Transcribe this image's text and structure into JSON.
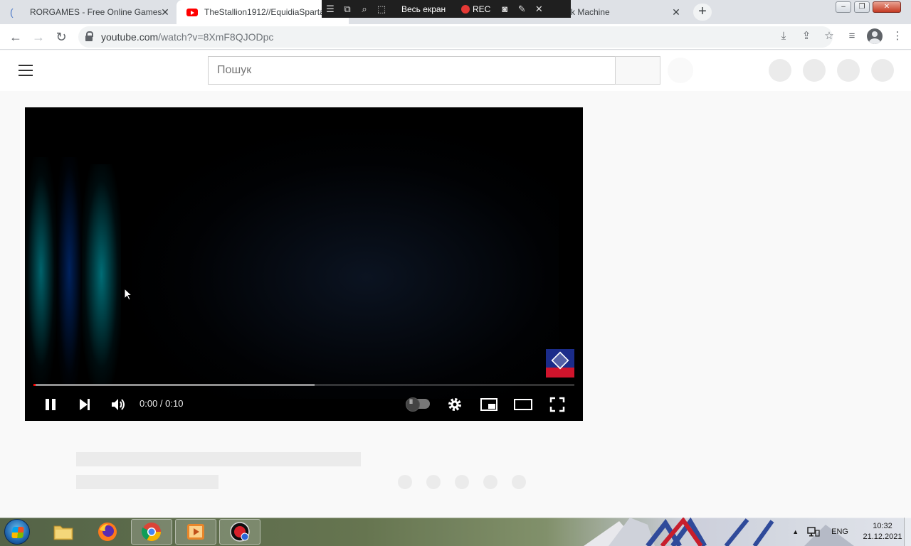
{
  "browser": {
    "tabs": [
      {
        "title": "RORGAMES - Free Online Games",
        "active": false
      },
      {
        "title": "TheStallion1912//EquidiaSparta",
        "active": true
      },
      {
        "title": "k Machine",
        "active": false
      }
    ],
    "close_glyph": "✕",
    "newtab_glyph": "+",
    "url_host": "youtube.com",
    "url_path": "/watch?v=8XmF8QJODpc"
  },
  "recorder": {
    "fullscreen_label": "Весь екран",
    "rec_label": "REC"
  },
  "youtube": {
    "search_placeholder": "Пошук",
    "player": {
      "time": "0:00 / 0:10",
      "played_fraction": 0.0,
      "buffered_fraction": 0.52
    }
  },
  "taskbar": {
    "language": "ENG",
    "time": "10:32",
    "date": "21.12.2021"
  },
  "colors": {
    "youtube_red": "#ff0000",
    "rec_red": "#e53935"
  }
}
